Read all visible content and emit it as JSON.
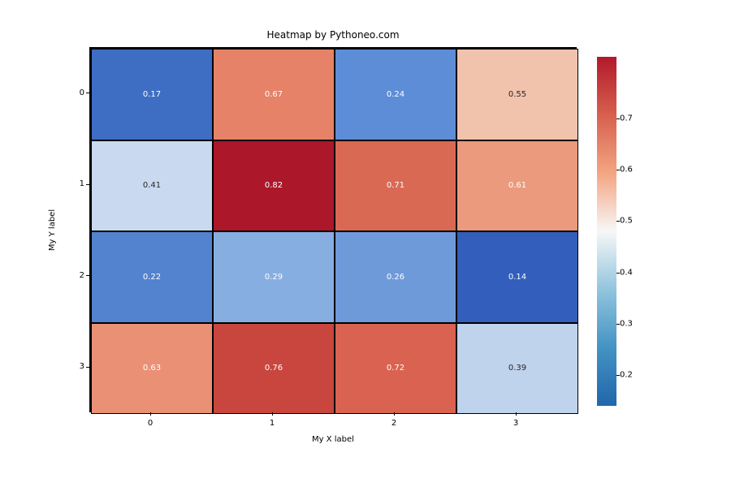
{
  "chart_data": {
    "type": "heatmap",
    "title": "Heatmap by Pythoneo.com",
    "xlabel": "My X label",
    "ylabel": "My Y label",
    "x_categories": [
      "0",
      "1",
      "2",
      "3"
    ],
    "y_categories": [
      "0",
      "1",
      "2",
      "3"
    ],
    "values": [
      [
        0.17,
        0.67,
        0.24,
        0.55
      ],
      [
        0.41,
        0.82,
        0.71,
        0.61
      ],
      [
        0.22,
        0.29,
        0.26,
        0.14
      ],
      [
        0.63,
        0.76,
        0.72,
        0.39
      ]
    ],
    "value_labels": [
      [
        "0.17",
        "0.67",
        "0.24",
        "0.55"
      ],
      [
        "0.41",
        "0.82",
        "0.71",
        "0.61"
      ],
      [
        "0.22",
        "0.29",
        "0.26",
        "0.14"
      ],
      [
        "0.63",
        "0.76",
        "0.72",
        "0.39"
      ]
    ],
    "cell_colors": [
      [
        "#3e6ec4",
        "#e58267",
        "#5d8dd6",
        "#f1c3ad"
      ],
      [
        "#c9daf0",
        "#ad172a",
        "#da6954",
        "#eb9a7d"
      ],
      [
        "#5382cf",
        "#87aee1",
        "#6e9ada",
        "#335ebb"
      ],
      [
        "#ea9075",
        "#c8463d",
        "#d96350",
        "#c0d3ed"
      ]
    ],
    "cell_text_dark": [
      [
        false,
        false,
        false,
        true
      ],
      [
        true,
        false,
        false,
        false
      ],
      [
        false,
        false,
        false,
        false
      ],
      [
        false,
        false,
        false,
        true
      ]
    ],
    "colorbar_ticks": [
      "0.2",
      "0.3",
      "0.4",
      "0.5",
      "0.6",
      "0.7"
    ],
    "vmin": 0.14,
    "vmax": 0.82
  }
}
